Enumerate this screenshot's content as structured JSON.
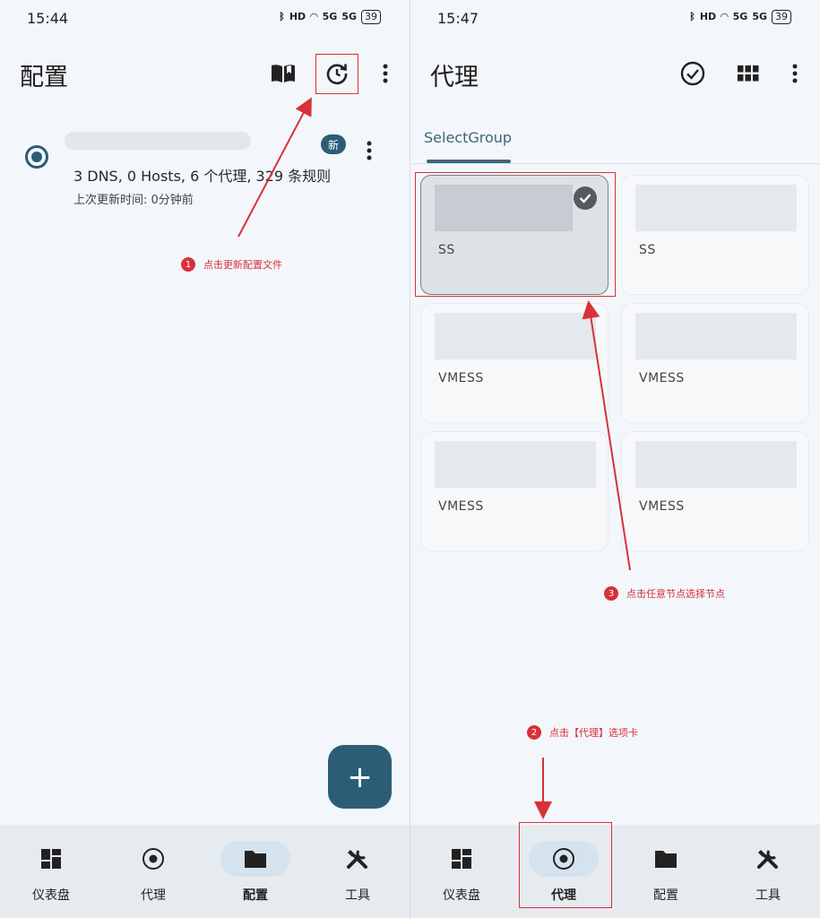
{
  "left_screen": {
    "status": {
      "time": "15:44",
      "battery": "39",
      "hd": "HD",
      "sig1": "5G",
      "sig2": "5G"
    },
    "title": "配置",
    "profile": {
      "badge": "新",
      "summary": "3 DNS, 0 Hosts, 6 个代理, 329 条规则",
      "updated": "上次更新时间: 0分钟前"
    },
    "fab_label": "+",
    "annotation": {
      "number": "1",
      "text": "点击更新配置文件"
    },
    "nav": [
      "仪表盘",
      "代理",
      "配置",
      "工具"
    ],
    "active_nav": "配置"
  },
  "right_screen": {
    "status": {
      "time": "15:47",
      "battery": "39",
      "hd": "HD",
      "sig1": "5G",
      "sig2": "5G"
    },
    "title": "代理",
    "tab": "SelectGroup",
    "cards": [
      {
        "type": "SS",
        "selected": true
      },
      {
        "type": "SS",
        "selected": false
      },
      {
        "type": "VMESS",
        "selected": false
      },
      {
        "type": "VMESS",
        "selected": false
      },
      {
        "type": "VMESS",
        "selected": false
      },
      {
        "type": "VMESS",
        "selected": false
      }
    ],
    "annotations": [
      {
        "number": "3",
        "text": "点击任意节点选择节点"
      },
      {
        "number": "2",
        "text": "点击【代理】选项卡"
      }
    ],
    "nav": [
      "仪表盘",
      "代理",
      "配置",
      "工具"
    ],
    "active_nav": "代理"
  },
  "icons": {
    "book": "book-open-icon",
    "refresh": "refresh-clock-icon",
    "more": "more-vert-icon",
    "check_circle": "check-circle-icon",
    "grid": "grid-view-icon",
    "dashboard": "dashboard-icon",
    "proxy": "radio-target-icon",
    "folder": "folder-icon",
    "tools": "tools-icon"
  },
  "colors": {
    "accent": "#2b5e76",
    "annotation_red": "#d8313a",
    "background": "#f3f6fa",
    "nav_background": "#e6ebf0"
  }
}
